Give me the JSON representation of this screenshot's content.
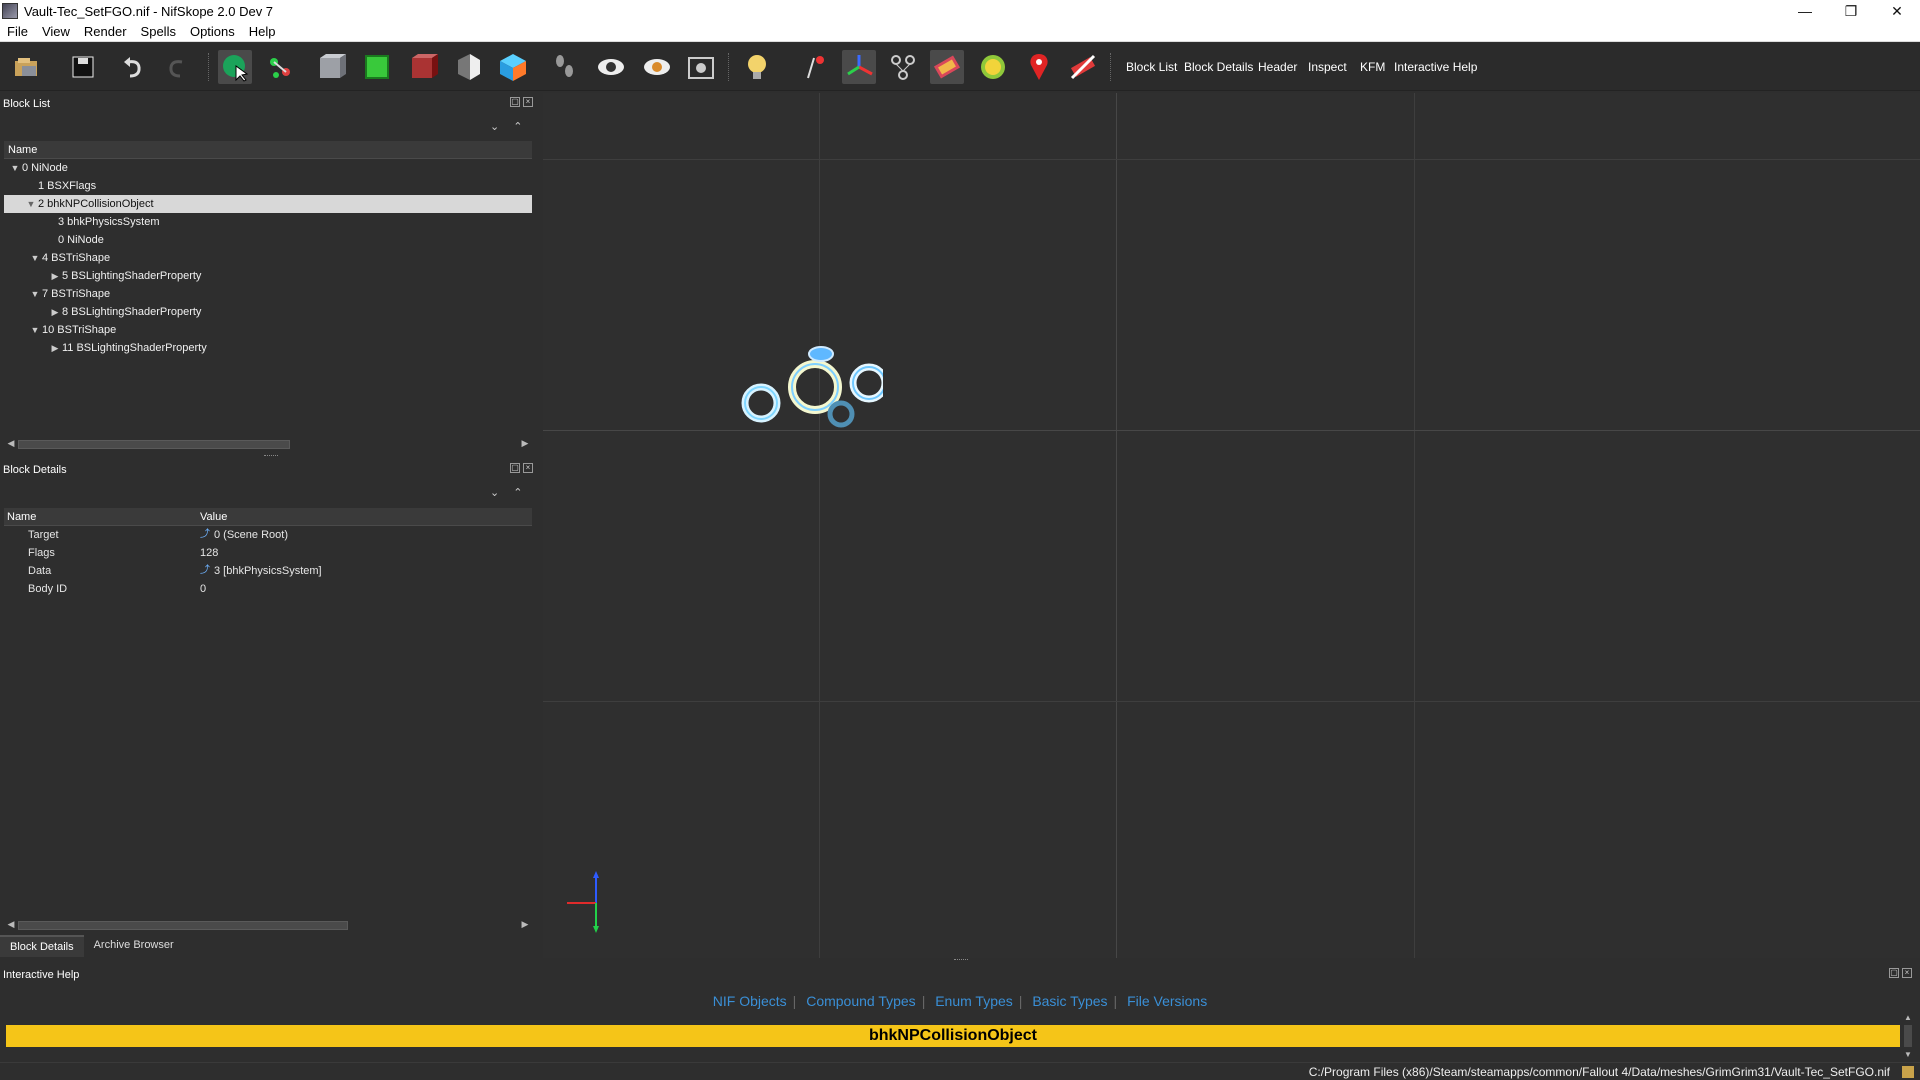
{
  "window": {
    "title": "Vault-Tec_SetFGO.nif - NifSkope 2.0 Dev 7",
    "minimize": "—",
    "maximize": "❐",
    "close": "✕"
  },
  "menu": [
    "File",
    "View",
    "Render",
    "Spells",
    "Options",
    "Help"
  ],
  "toolbar": {
    "panel_buttons": [
      "Block List",
      "Block Details",
      "Header",
      "Inspect",
      "KFM",
      "Interactive Help"
    ]
  },
  "block_list": {
    "title": "Block List",
    "column": "Name",
    "rows": [
      {
        "label": "0 NiNode",
        "arrow": "▼"
      },
      {
        "label": "1 BSXFlags",
        "arrow": ""
      },
      {
        "label": "2 bhkNPCollisionObject",
        "arrow": "▼"
      },
      {
        "label": "3 bhkPhysicsSystem",
        "arrow": ""
      },
      {
        "label": "0 NiNode",
        "arrow": ""
      },
      {
        "label": "4 BSTriShape",
        "arrow": "▼"
      },
      {
        "label": "5 BSLightingShaderProperty",
        "arrow": "▶"
      },
      {
        "label": "7 BSTriShape",
        "arrow": "▼"
      },
      {
        "label": "8 BSLightingShaderProperty",
        "arrow": "▶"
      },
      {
        "label": "10 BSTriShape",
        "arrow": "▼"
      },
      {
        "label": "11 BSLightingShaderProperty",
        "arrow": "▶"
      }
    ]
  },
  "block_details": {
    "title": "Block Details",
    "col_name": "Name",
    "col_value": "Value",
    "rows": [
      {
        "name": "Target",
        "value": "0 (Scene Root)",
        "link": true
      },
      {
        "name": "Flags",
        "value": "128",
        "link": false
      },
      {
        "name": "Data",
        "value": "3 [bhkPhysicsSystem]",
        "link": true
      },
      {
        "name": "Body ID",
        "value": "0",
        "link": false
      }
    ]
  },
  "bottom_tabs": [
    "Block Details",
    "Archive Browser"
  ],
  "interactive_help": {
    "title": "Interactive Help",
    "links": [
      "NIF Objects",
      "Compound Types",
      "Enum Types",
      "Basic Types",
      "File Versions"
    ],
    "heading": "bhkNPCollisionObject"
  },
  "status": {
    "path": "C:/Program Files (x86)/Steam/steamapps/common/Fallout 4/Data/meshes/GrimGrim31/Vault-Tec_SetFGO.nif"
  },
  "colors": {
    "help_heading_bg": "#f5c518",
    "link": "#3a8fd6",
    "selection": "#d8d8d8"
  }
}
